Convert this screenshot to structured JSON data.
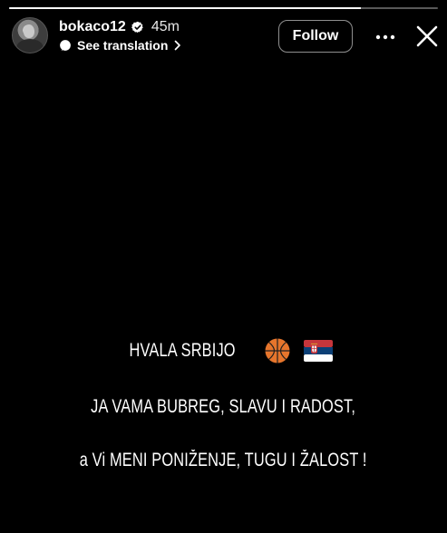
{
  "story": {
    "progress_fraction": 0.82,
    "author": {
      "username": "bokaco12",
      "verified": true,
      "posted_ago": "45m",
      "translation_label": "See translation"
    },
    "actions": {
      "follow_label": "Follow",
      "more_icon": "more-horizontal-icon",
      "close_icon": "close-icon"
    },
    "text_lines": [
      "HVALA SRBIJO",
      "JA VAMA BUBREG, SLAVU I RADOST,",
      "a Vi MENI PONIŽENJE, TUGU I ŽALOST !"
    ],
    "emojis": {
      "basketball": "basketball-icon",
      "flag": "serbia-flag-icon"
    }
  },
  "colors": {
    "background": "#000000",
    "text": "#ffffff",
    "button_border": "#8f8f8f",
    "progress_track": "#5a5a5a",
    "progress_fill": "#ffffff",
    "basketball": "#e6752c",
    "flag_red": "#c6363c",
    "flag_blue": "#0c4076",
    "flag_white": "#ffffff"
  }
}
